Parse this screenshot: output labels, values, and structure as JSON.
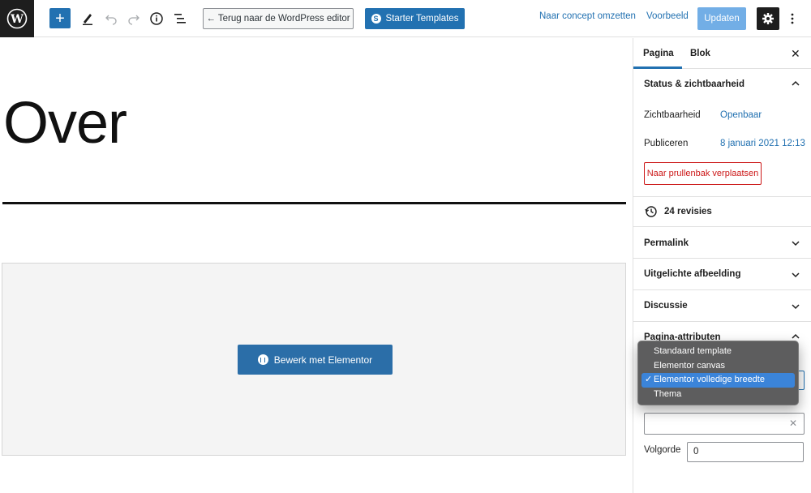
{
  "toolbar": {
    "back_label": "← Terug naar de WordPress editor",
    "starter_label": "Starter Templates",
    "draft_label": "Naar concept omzetten",
    "preview_label": "Voorbeeld",
    "update_label": "Updaten",
    "icons": [
      "wordpress-logo",
      "plus-icon",
      "pencil-icon",
      "undo-icon",
      "redo-icon",
      "info-icon",
      "list-view-icon",
      "gear-icon",
      "more-vertical-icon"
    ]
  },
  "editor": {
    "title": "Over",
    "elementor_button": "Bewerk met Elementor"
  },
  "sidebar": {
    "tabs": [
      "Pagina",
      "Blok"
    ],
    "status_title": "Status & zichtbaarheid",
    "visibility_label": "Zichtbaarheid",
    "visibility_value": "Openbaar",
    "publish_label": "Publiceren",
    "publish_value": "8 januari 2021 12:13",
    "trash_label": "Naar prullenbak verplaatsen",
    "revisions_label": "24 revisies",
    "permalink_title": "Permalink",
    "featured_title": "Uitgelichte afbeelding",
    "discussion_title": "Discussie",
    "attributes_title": "Pagina-attributen",
    "order_label": "Volgorde",
    "order_value": "0"
  },
  "template_dropdown": {
    "options": [
      "Standaard template",
      "Elementor canvas",
      "Elementor volledige breedte",
      "Thema"
    ],
    "selected": "Elementor volledige breedte"
  },
  "colors": {
    "accent": "#2271b1",
    "dark": "#1e1e1e",
    "danger": "#cc1818"
  }
}
